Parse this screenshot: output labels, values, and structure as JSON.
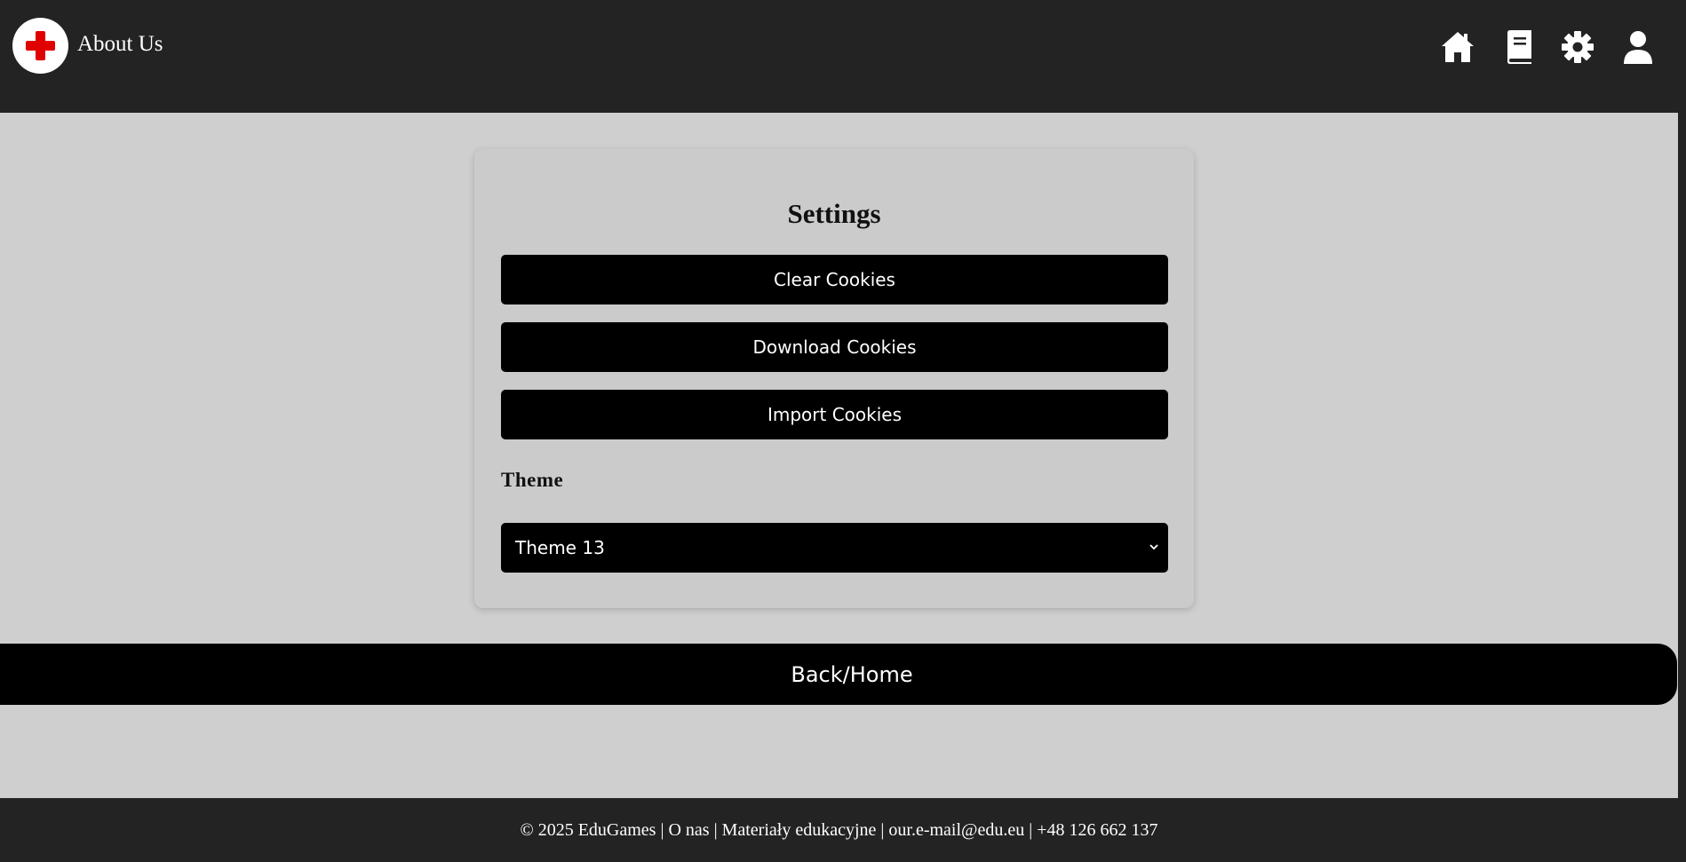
{
  "header": {
    "title": "About Us",
    "logo_icon": "red-cross-icon",
    "nav_icons": [
      "home-icon",
      "book-icon",
      "gear-icon",
      "user-icon"
    ]
  },
  "settings": {
    "title": "Settings",
    "buttons": [
      "Clear Cookies",
      "Download Cookies",
      "Import Cookies"
    ],
    "theme_label": "Theme",
    "theme_selected": "Theme 13"
  },
  "back_button": "Back/Home",
  "footer": {
    "text": "© 2025 EduGames | O nas | Materiały edukacyjne | our.e-mail@edu.eu | +48 126 662 137"
  },
  "colors": {
    "header_bg": "#232323",
    "page_bg": "#cfcfcf",
    "button_bg": "#000000",
    "logo_cross": "#e00000"
  }
}
